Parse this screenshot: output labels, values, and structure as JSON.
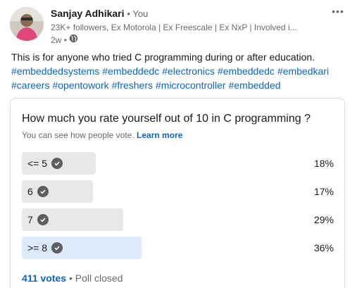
{
  "author": {
    "name": "Sanjay Adhikari",
    "relation": "• You",
    "headline": "23K+ followers, Ex Motorola | Ex Freescale | Ex NxP | Involved i...",
    "time": "2w •"
  },
  "post": {
    "text": "This is for anyone who tried C programming during or after education.",
    "hashtags": [
      "#embeddedsystems",
      "#embeddedc",
      "#electronics",
      "#embeddedc",
      "#embedkari",
      "#careers",
      "#opentowork",
      "#freshers",
      "#microcontroller",
      "#embedded"
    ]
  },
  "poll": {
    "question": "How much you rate yourself out of 10 in C programming ?",
    "visibility_text": "You can see how people vote.",
    "learn_more": "Learn more",
    "options": [
      {
        "label": "<= 5",
        "percent_text": "18%",
        "percent": 18,
        "selected": false
      },
      {
        "label": "6",
        "percent_text": "17%",
        "percent": 17,
        "selected": false
      },
      {
        "label": "7",
        "percent_text": "29%",
        "percent": 29,
        "selected": false
      },
      {
        "label": ">= 8",
        "percent_text": "36%",
        "percent": 36,
        "selected": true
      }
    ],
    "votes": "411 votes",
    "status": "• Poll closed"
  },
  "icons": {
    "more": "more-options-icon",
    "globe": "globe-icon",
    "check": "checkmark-icon"
  },
  "colors": {
    "link": "#0a66c2",
    "bar": "#e8e8e8",
    "bar_selected": "#dbe9fb",
    "check_bg": "#5e5e5e"
  }
}
